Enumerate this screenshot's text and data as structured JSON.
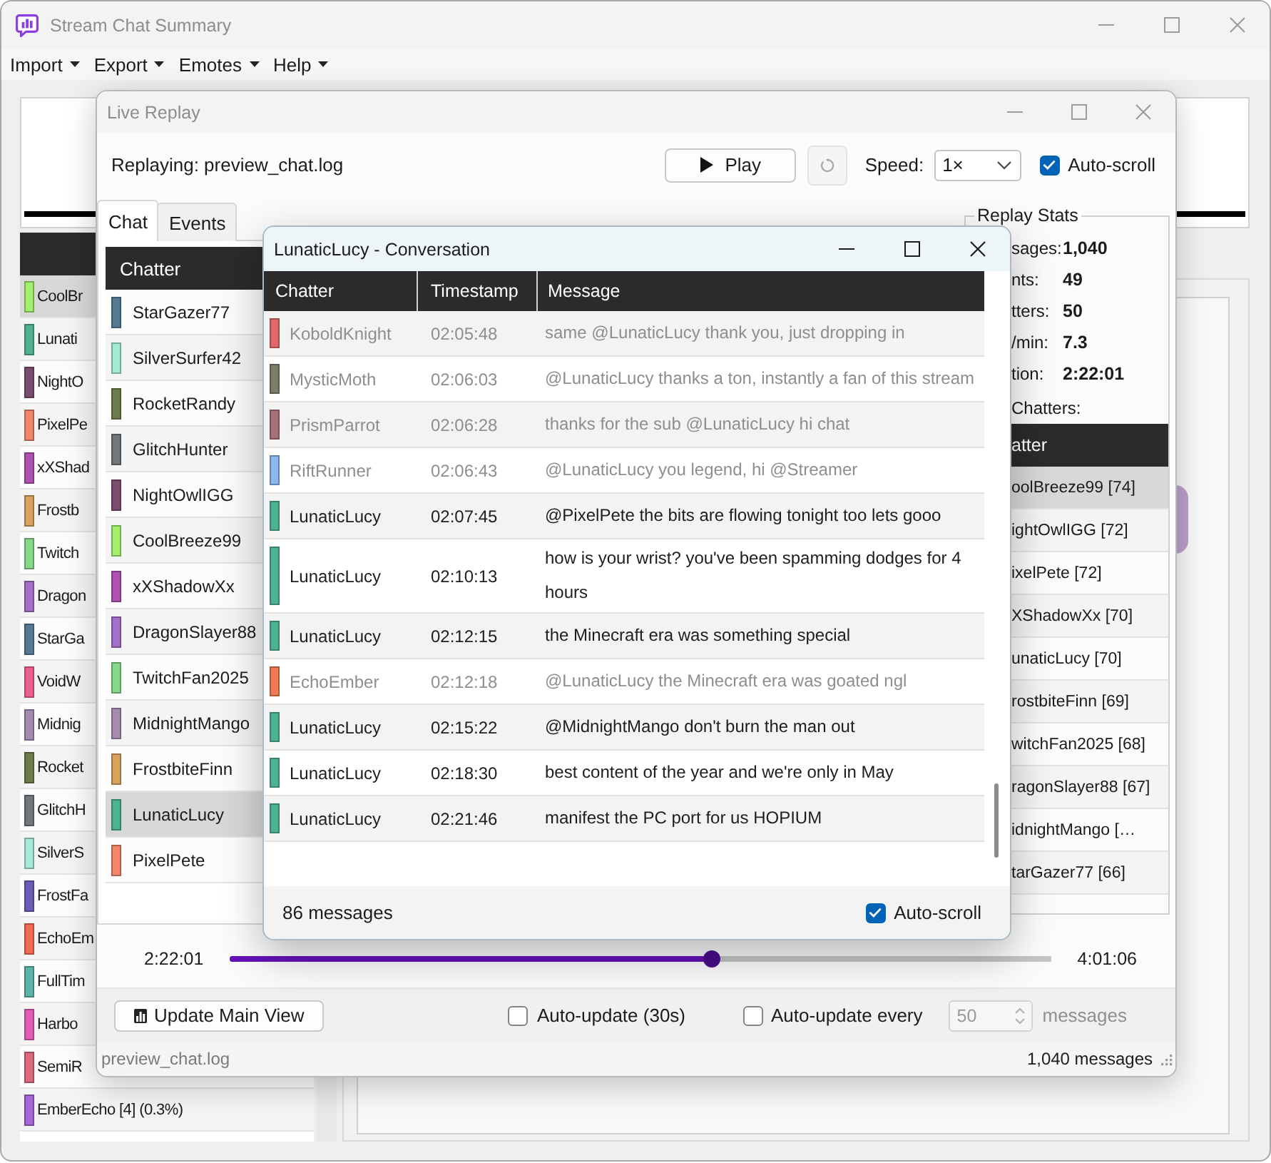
{
  "main_window": {
    "title": "Stream Chat Summary",
    "active": false,
    "menus": [
      {
        "label": "Import"
      },
      {
        "label": "Export"
      },
      {
        "label": "Emotes"
      },
      {
        "label": "Help"
      }
    ],
    "chatters": [
      {
        "name": "CoolBr",
        "color": "#a6ef6e",
        "selected": true
      },
      {
        "name": "Lunati",
        "color": "#4fb393",
        "selected": false
      },
      {
        "name": "NightO",
        "color": "#7b4d6e",
        "selected": false
      },
      {
        "name": "PixelPe",
        "color": "#f2876b",
        "selected": false
      },
      {
        "name": "xXShad",
        "color": "#b052b4",
        "selected": false
      },
      {
        "name": "Frostb",
        "color": "#d9a25f",
        "selected": false
      },
      {
        "name": "Twitch",
        "color": "#86d98a",
        "selected": false
      },
      {
        "name": "Dragon",
        "color": "#a26fc9",
        "selected": false
      },
      {
        "name": "StarGa",
        "color": "#557a92",
        "selected": false
      },
      {
        "name": "VoidW",
        "color": "#e9628e",
        "selected": false
      },
      {
        "name": "Midnig",
        "color": "#a68bb0",
        "selected": false
      },
      {
        "name": "Rocket",
        "color": "#6b7d4a",
        "selected": false
      },
      {
        "name": "GlitchH",
        "color": "#72777b",
        "selected": false
      },
      {
        "name": "SilverS",
        "color": "#a5ecd8",
        "selected": false
      },
      {
        "name": "FrostFa",
        "color": "#6b5fb5",
        "selected": false
      },
      {
        "name": "EchoEm",
        "color": "#f26b4f",
        "selected": false
      },
      {
        "name": "FullTim",
        "color": "#5fb3ad",
        "selected": false
      },
      {
        "name": "Harbo",
        "color": "#e25db8",
        "selected": false
      },
      {
        "name": "SemiR",
        "color": "#dd6b7c",
        "selected": false
      },
      {
        "name": "EmberEcho [4] (0.3%)",
        "color": "#a567d9",
        "selected": false
      }
    ]
  },
  "replay_window": {
    "title": "Live Replay",
    "active": false,
    "file_label": "Replaying: preview_chat.log",
    "play_button": {
      "label": "Play"
    },
    "reset_button": {
      "disabled": true
    },
    "speed": {
      "label": "Speed:",
      "value": "1×"
    },
    "auto_scroll": {
      "label": "Auto-scroll",
      "checked": true
    },
    "tabs": [
      {
        "label": "Chat",
        "selected": true
      },
      {
        "label": "Events",
        "selected": false
      }
    ],
    "chat_list": {
      "columns": [
        "Chatter"
      ],
      "rows": [
        {
          "name": "StarGazer77",
          "color": "#557a92",
          "selected": false
        },
        {
          "name": "SilverSurfer42",
          "color": "#a5ecd8",
          "selected": false
        },
        {
          "name": "RocketRandy",
          "color": "#6b7d4a",
          "selected": false
        },
        {
          "name": "GlitchHunter",
          "color": "#72777b",
          "selected": false
        },
        {
          "name": "NightOwlIGG",
          "color": "#7b4d6e",
          "selected": false
        },
        {
          "name": "CoolBreeze99",
          "color": "#a6ef6e",
          "selected": false
        },
        {
          "name": "xXShadowXx",
          "color": "#b052b4",
          "selected": false
        },
        {
          "name": "DragonSlayer88",
          "color": "#a26fc9",
          "selected": false
        },
        {
          "name": "TwitchFan2025",
          "color": "#86d98a",
          "selected": false
        },
        {
          "name": "MidnightMango",
          "color": "#a68bb0",
          "selected": false
        },
        {
          "name": "FrostbiteFinn",
          "color": "#d9a25f",
          "selected": false
        },
        {
          "name": "LunaticLucy",
          "color": "#4fb393",
          "selected": true
        },
        {
          "name": "PixelPete",
          "color": "#f2876b",
          "selected": false
        }
      ]
    },
    "stats": {
      "title": "Replay Stats",
      "items": [
        {
          "label": "sages:",
          "value": "1,040"
        },
        {
          "label": "nts:",
          "value": "49"
        },
        {
          "label": "tters:",
          "value": "50"
        },
        {
          "label": "/min:",
          "value": "7.3"
        },
        {
          "label": "tion:",
          "value": "2:22:01"
        }
      ],
      "top_label": "Chatters:",
      "top_columns": [
        "atter"
      ],
      "top_chatters": [
        {
          "text": "oolBreeze99 [74]",
          "selected": true
        },
        {
          "text": "ightOwlIGG [72]",
          "selected": false
        },
        {
          "text": "ixelPete [72]",
          "selected": false
        },
        {
          "text": "XShadowXx [70]",
          "selected": false
        },
        {
          "text": "unaticLucy [70]",
          "selected": false
        },
        {
          "text": "rostbiteFinn [69]",
          "selected": false
        },
        {
          "text": "witchFan2025 [68]",
          "selected": false
        },
        {
          "text": "ragonSlayer88 [67]",
          "selected": false
        },
        {
          "text": "idnightMango […",
          "selected": false
        },
        {
          "text": "tarGazer77 [66]",
          "selected": false
        }
      ]
    },
    "timeline": {
      "start": "2:22:01",
      "end": "4:01:06",
      "level": 0.587
    },
    "update_button": {
      "label": "Update Main View"
    },
    "auto_update": {
      "label": "Auto-update (30s)",
      "checked": false
    },
    "auto_update_every": {
      "label": "Auto-update every",
      "checked": false,
      "value": "50",
      "unit": "messages",
      "disabled": true
    },
    "status_bar": {
      "file": "preview_chat.log",
      "count": "1,040 messages"
    }
  },
  "conversation_window": {
    "title": "LunaticLucy - Conversation",
    "active": true,
    "columns": [
      "Chatter",
      "Timestamp",
      "Message"
    ],
    "rows": [
      {
        "chatter": "KoboldKnight",
        "color": "#e06a6a",
        "time": "02:05:48",
        "message": "same @LunaticLucy thank you, just dropping in",
        "dimmed": true
      },
      {
        "chatter": "MysticMoth",
        "color": "#7e7d6a",
        "time": "02:06:03",
        "message": "@LunaticLucy thanks a ton, instantly a fan of this stream",
        "dimmed": true
      },
      {
        "chatter": "PrismParrot",
        "color": "#a8727a",
        "time": "02:06:28",
        "message": "thanks for the sub @LunaticLucy hi chat",
        "dimmed": true
      },
      {
        "chatter": "RiftRunner",
        "color": "#8db8ef",
        "time": "02:06:43",
        "message": "@LunaticLucy you legend, hi @Streamer",
        "dimmed": true
      },
      {
        "chatter": "LunaticLucy",
        "color": "#4fb393",
        "time": "02:07:45",
        "message": "@PixelPete the bits are flowing tonight too lets gooo",
        "dimmed": false
      },
      {
        "chatter": "LunaticLucy",
        "color": "#4fb393",
        "time": "02:10:13",
        "message": "how is your wrist? you've been spamming dodges for 4 hours",
        "dimmed": false
      },
      {
        "chatter": "LunaticLucy",
        "color": "#4fb393",
        "time": "02:12:15",
        "message": "the Minecraft era was something special",
        "dimmed": false
      },
      {
        "chatter": "EchoEmber",
        "color": "#f07a52",
        "time": "02:12:18",
        "message": "@LunaticLucy the Minecraft era was goated ngl",
        "dimmed": true
      },
      {
        "chatter": "LunaticLucy",
        "color": "#4fb393",
        "time": "02:15:22",
        "message": "@MidnightMango don't burn the man out",
        "dimmed": false
      },
      {
        "chatter": "LunaticLucy",
        "color": "#4fb393",
        "time": "02:18:30",
        "message": "best content of the year and we're only in May",
        "dimmed": false
      },
      {
        "chatter": "LunaticLucy",
        "color": "#4fb393",
        "time": "02:21:46",
        "message": "manifest the PC port for us HOPIUM",
        "dimmed": false
      }
    ],
    "count": "86 messages",
    "auto_scroll": {
      "label": "Auto-scroll",
      "checked": true
    }
  }
}
